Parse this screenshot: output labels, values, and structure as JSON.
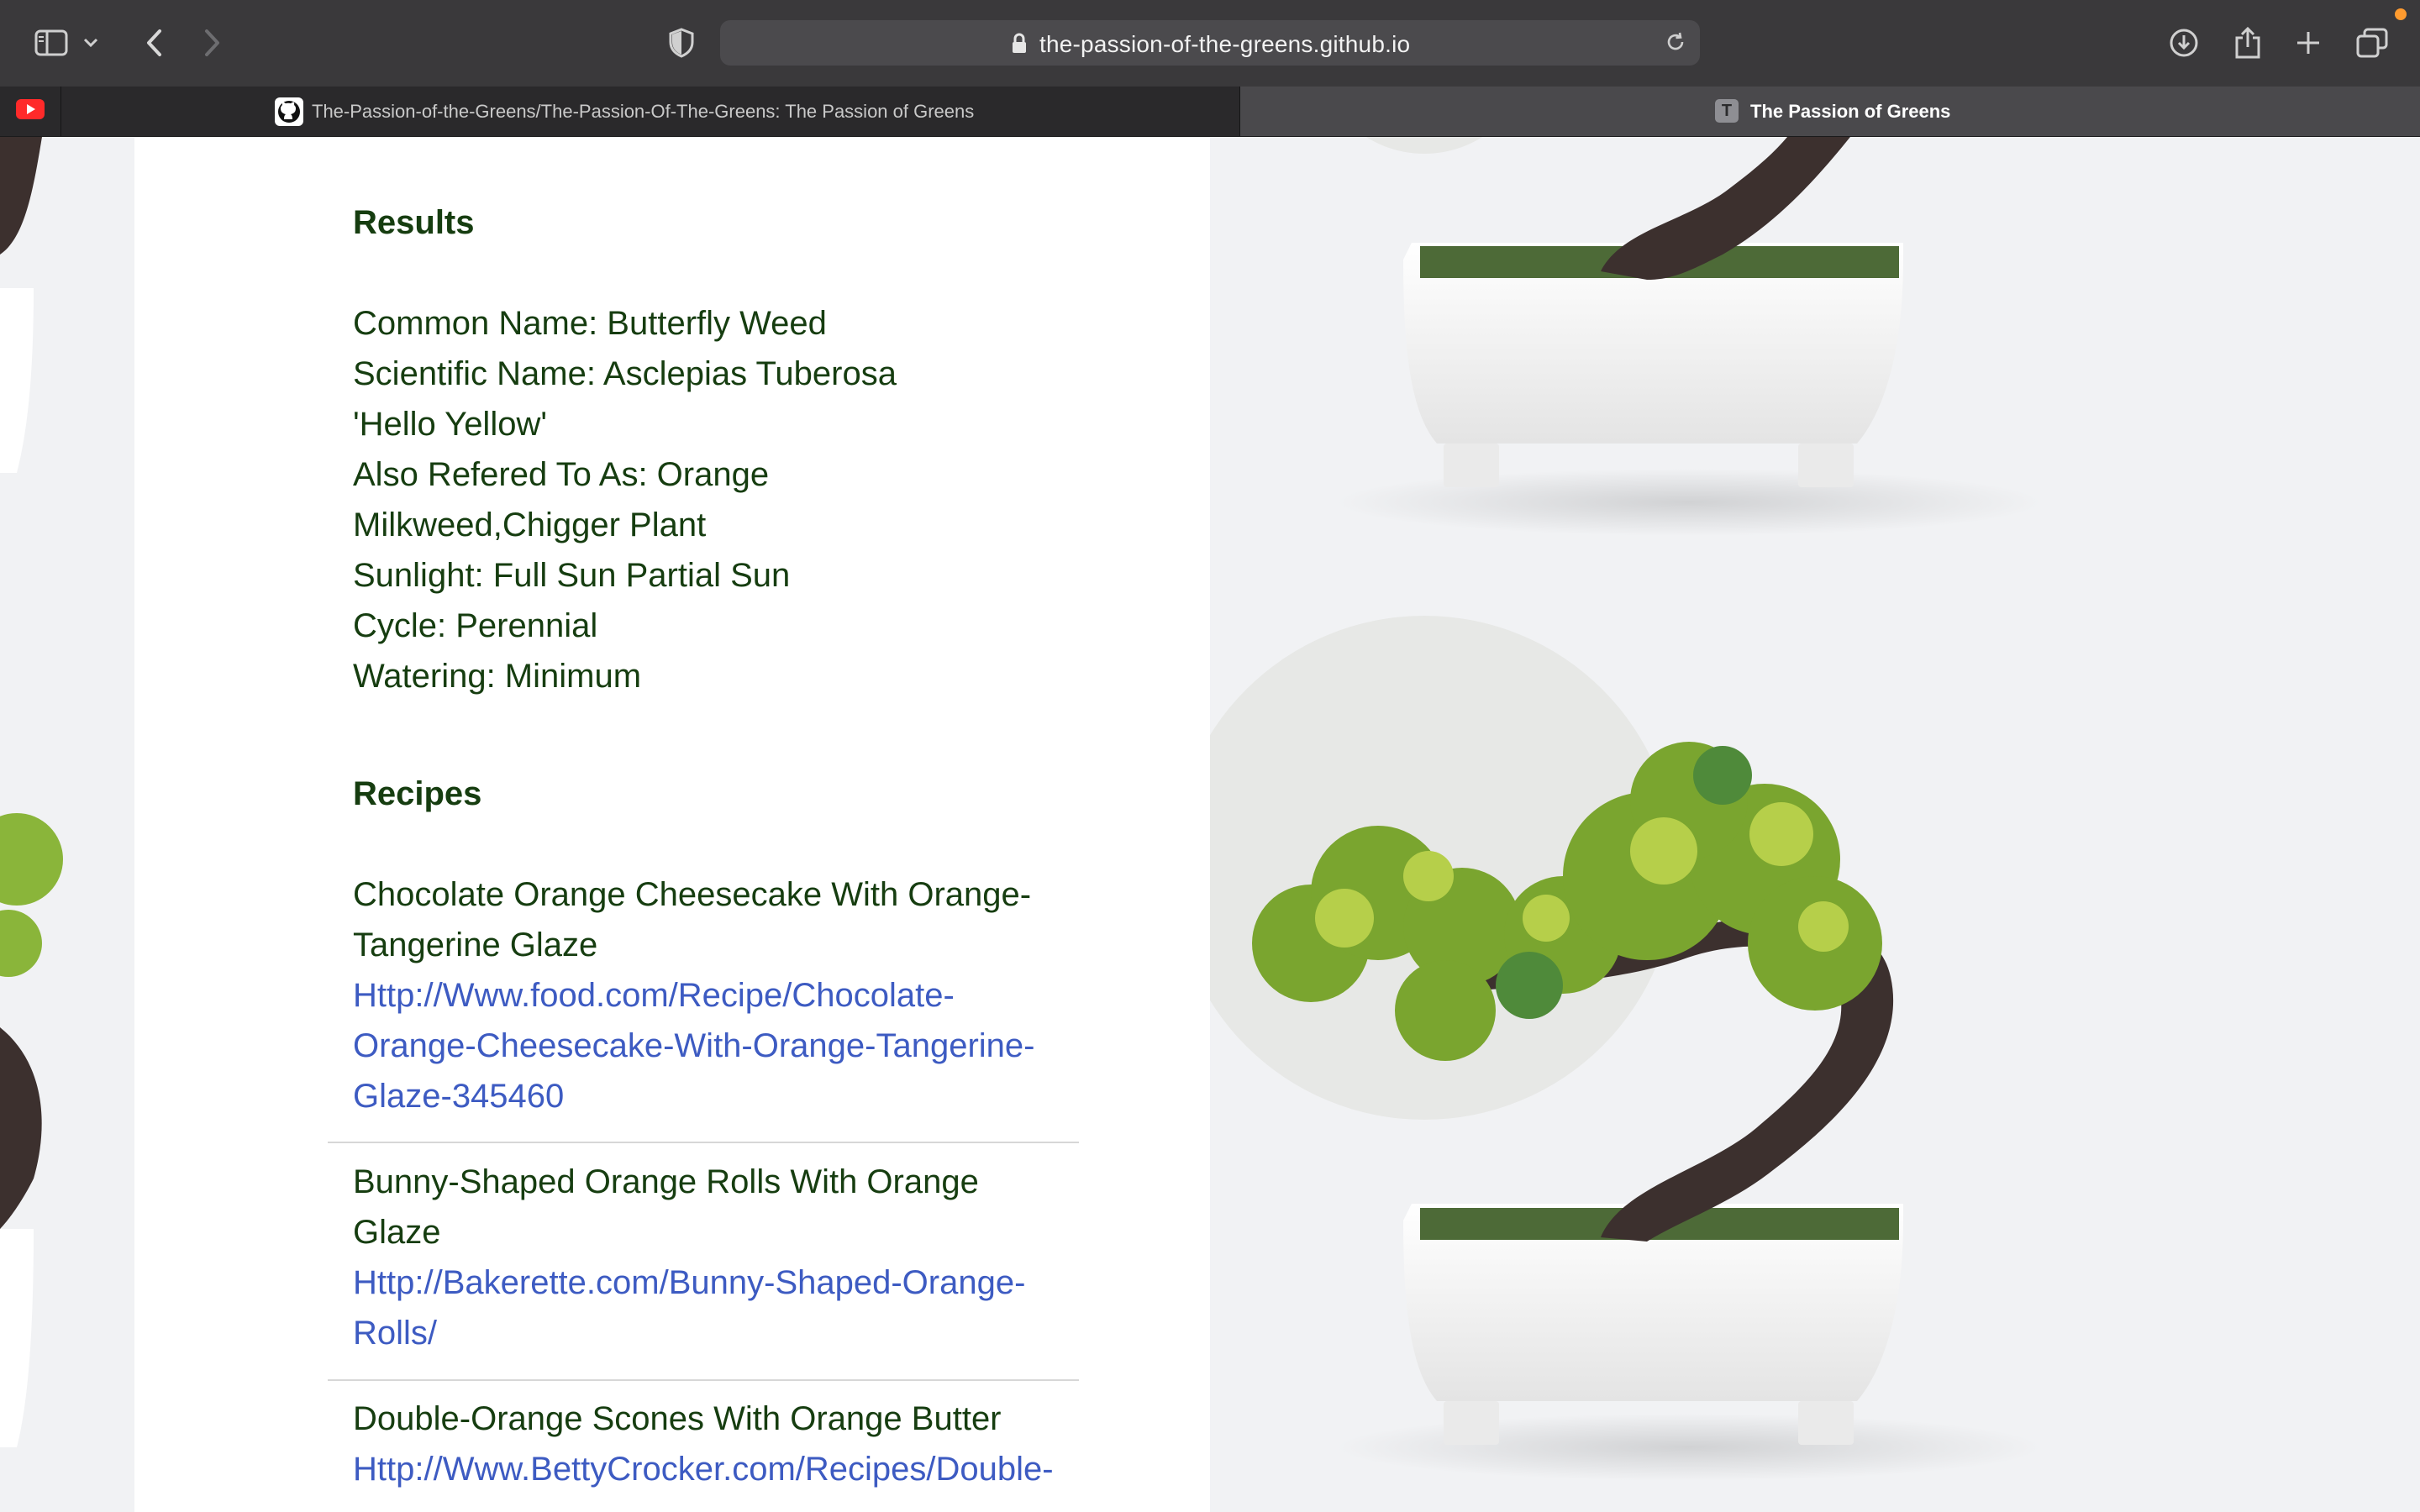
{
  "browser": {
    "url": "the-passion-of-the-greens.github.io",
    "tabs": [
      {
        "title": "The-Passion-of-the-Greens/The-Passion-Of-The-Greens: The Passion of Greens"
      },
      {
        "title": "The Passion of Greens",
        "favicon_letter": "T"
      }
    ],
    "icons": [
      "sidebar-icon",
      "chevron-down-icon",
      "back-icon",
      "forward-icon",
      "privacy-shield-icon",
      "lock-icon",
      "reload-icon",
      "download-icon",
      "share-icon",
      "new-tab-icon",
      "tab-overview-icon",
      "youtube-icon",
      "github-icon"
    ]
  },
  "results": {
    "heading": "Results",
    "common_name": "Common Name: Butterfly Weed",
    "scientific_name": "Scientific Name: Asclepias Tuberosa",
    "cultivar": "'Hello Yellow'",
    "aka_line1": "Also Refered To As: Orange",
    "aka_line2": "Milkweed,Chigger Plant",
    "sunlight": "Sunlight: Full Sun Partial Sun",
    "cycle": "Cycle: Perennial",
    "watering": "Watering: Minimum"
  },
  "recipes": {
    "heading": "Recipes",
    "items": [
      {
        "title_l1": "Chocolate Orange Cheesecake With Orange-",
        "title_l2": "Tangerine Glaze",
        "link_l1": "Http://Www.food.com/Recipe/Chocolate-",
        "link_l2": "Orange-Cheesecake-With-Orange-Tangerine-",
        "link_l3": "Glaze-345460"
      },
      {
        "title_l1": "Bunny-Shaped Orange Rolls With Orange",
        "title_l2": "Glaze",
        "link_l1": "Http://Bakerette.com/Bunny-Shaped-Orange-",
        "link_l2": "Rolls/"
      },
      {
        "title_l1": "Double-Orange Scones With Orange Butter",
        "link_l1": "Http://Www.BettyCrocker.com/Recipes/Double-"
      }
    ]
  },
  "colors": {
    "text": "#163d10",
    "link": "#3d5bc2",
    "chrome": "#3a393b"
  }
}
